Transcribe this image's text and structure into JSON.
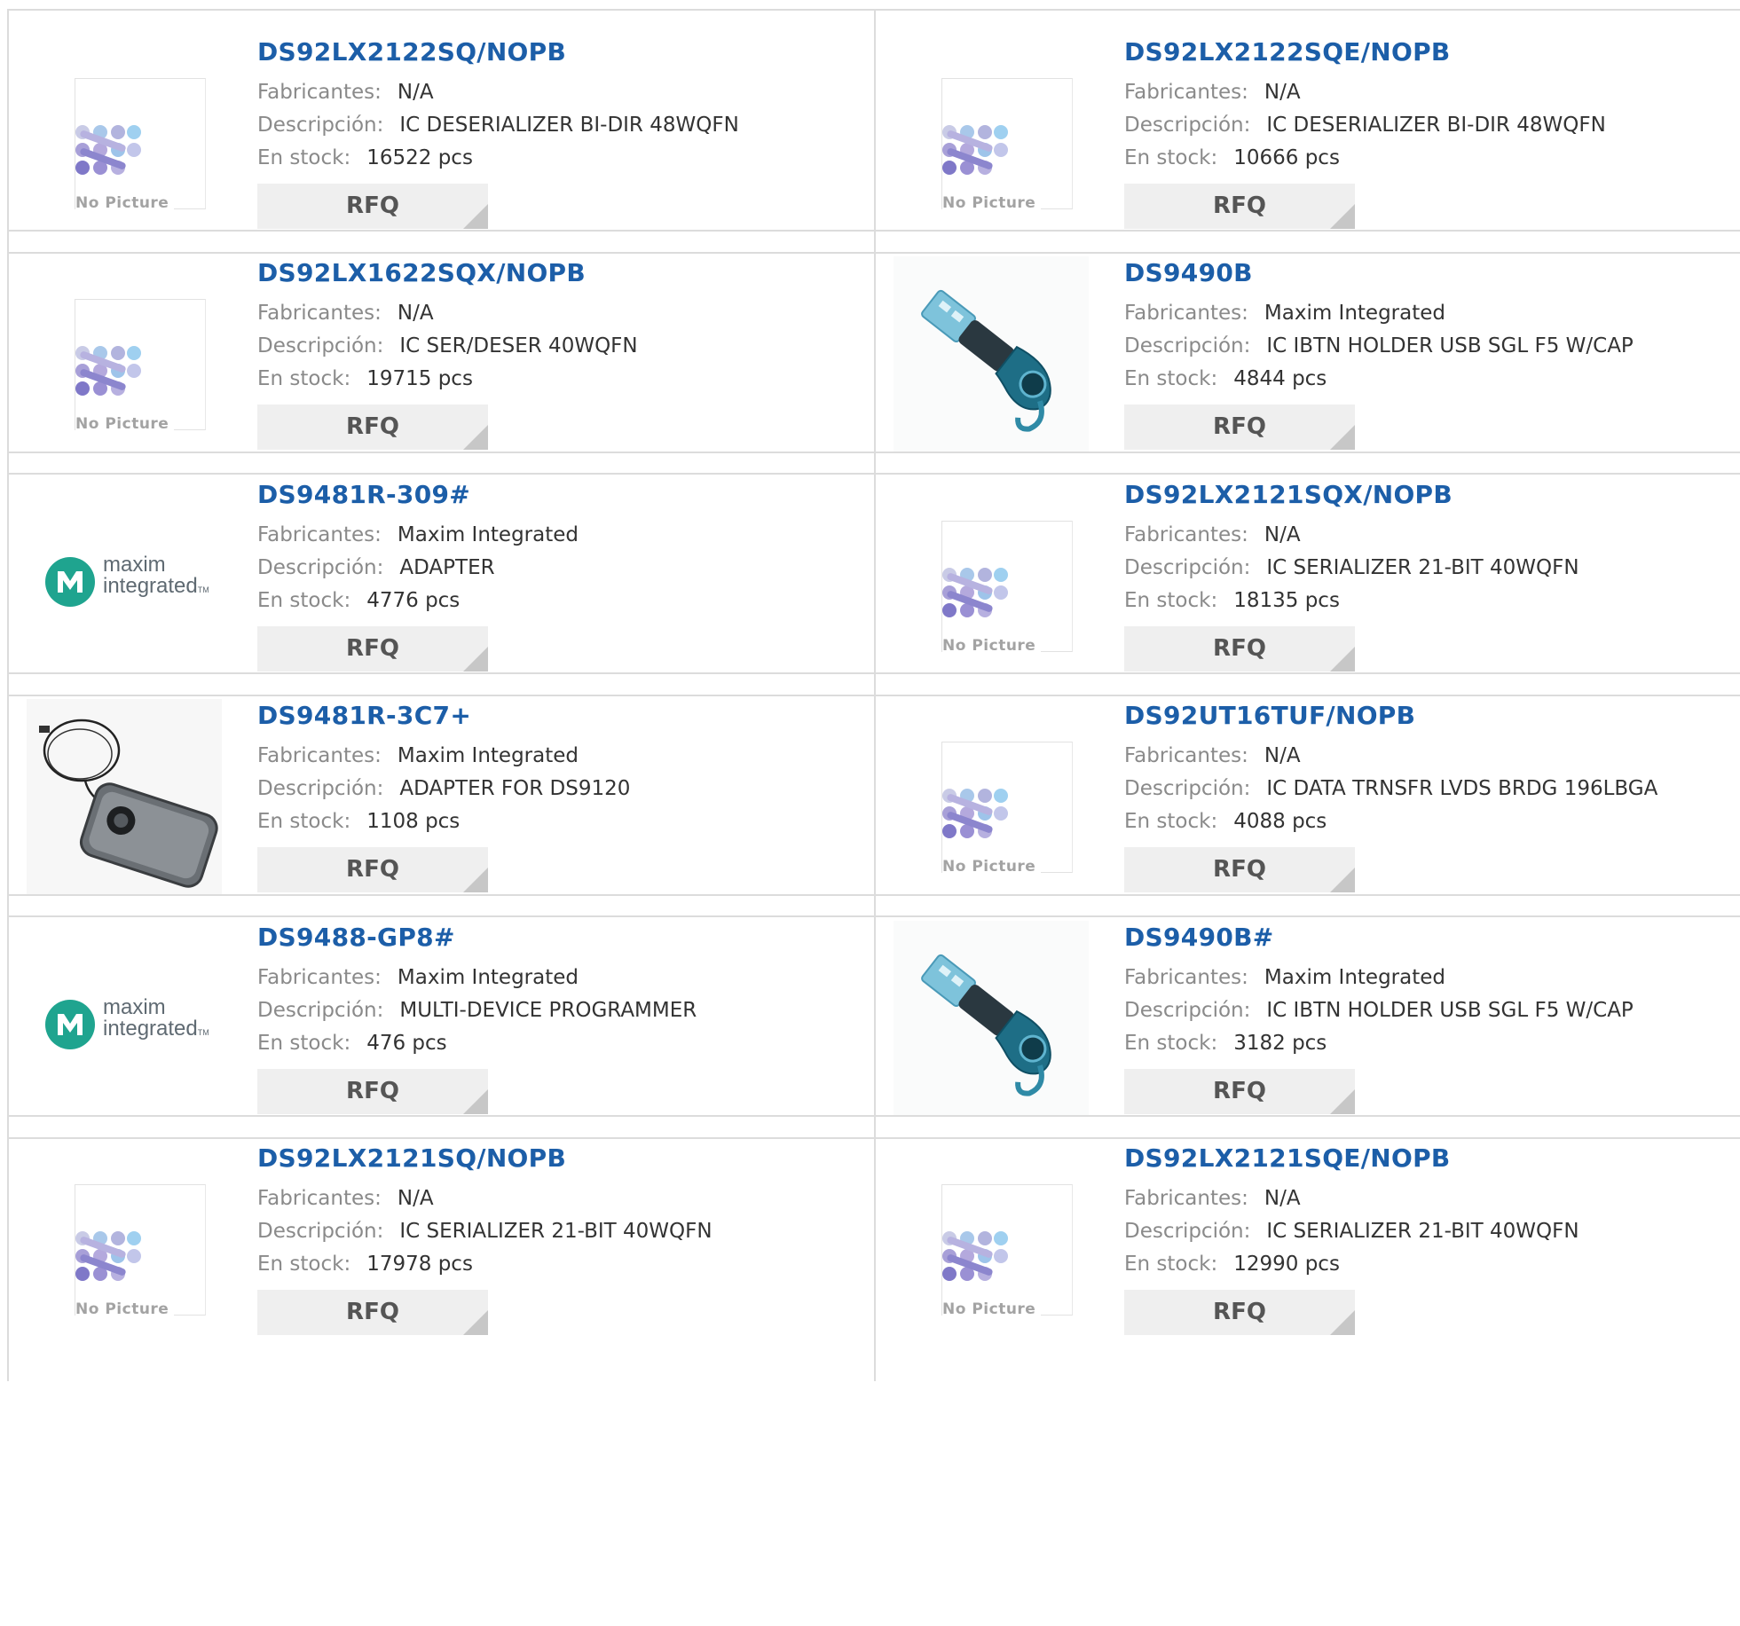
{
  "labels": {
    "manufacturer": "Fabricantes:",
    "description": "Descripción:",
    "stock": "En stock:",
    "rfq": "RFQ",
    "no_picture": "No Picture",
    "maxim_line1": "maxim",
    "maxim_line2": "integrated",
    "maxim_tm": "TM"
  },
  "colors": {
    "part_link": "#1c5ea8",
    "label_grey": "#8a8a8a",
    "value_text": "#333333",
    "rfq_bg": "#efefef",
    "border": "#dcdcdc",
    "maxim_teal": "#1fa48f"
  },
  "products": [
    {
      "part": "DS92LX2122SQ/NOPB",
      "manufacturer": "N/A",
      "description": "IC DESERIALIZER BI-DIR 48WQFN",
      "stock": "16522 pcs",
      "image": "no-picture"
    },
    {
      "part": "DS92LX2122SQE/NOPB",
      "manufacturer": "N/A",
      "description": "IC DESERIALIZER BI-DIR 48WQFN",
      "stock": "10666 pcs",
      "image": "no-picture"
    },
    {
      "part": "DS92LX1622SQX/NOPB",
      "manufacturer": "N/A",
      "description": "IC SER/DESER 40WQFN",
      "stock": "19715 pcs",
      "image": "no-picture"
    },
    {
      "part": "DS9490B",
      "manufacturer": "Maxim Integrated",
      "description": "IC IBTN HOLDER USB SGL F5 W/CAP",
      "stock": "4844 pcs",
      "image": "usb-holder"
    },
    {
      "part": "DS9481R-309#",
      "manufacturer": "Maxim Integrated",
      "description": "ADAPTER",
      "stock": "4776 pcs",
      "image": "maxim-logo"
    },
    {
      "part": "DS92LX2121SQX/NOPB",
      "manufacturer": "N/A",
      "description": "IC SERIALIZER 21-BIT 40WQFN",
      "stock": "18135 pcs",
      "image": "no-picture"
    },
    {
      "part": "DS9481R-3C7+",
      "manufacturer": "Maxim Integrated",
      "description": "ADAPTER FOR DS9120",
      "stock": "1108 pcs",
      "image": "adapter-device"
    },
    {
      "part": "DS92UT16TUF/NOPB",
      "manufacturer": "N/A",
      "description": "IC DATA TRNSFR LVDS BRDG 196LBGA",
      "stock": "4088 pcs",
      "image": "no-picture"
    },
    {
      "part": "DS9488-GP8#",
      "manufacturer": "Maxim Integrated",
      "description": "MULTI-DEVICE PROGRAMMER",
      "stock": "476 pcs",
      "image": "maxim-logo"
    },
    {
      "part": "DS9490B#",
      "manufacturer": "Maxim Integrated",
      "description": "IC IBTN HOLDER USB SGL F5 W/CAP",
      "stock": "3182 pcs",
      "image": "usb-holder"
    },
    {
      "part": "DS92LX2121SQ/NOPB",
      "manufacturer": "N/A",
      "description": "IC SERIALIZER 21-BIT 40WQFN",
      "stock": "17978 pcs",
      "image": "no-picture"
    },
    {
      "part": "DS92LX2121SQE/NOPB",
      "manufacturer": "N/A",
      "description": "IC SERIALIZER 21-BIT 40WQFN",
      "stock": "12990 pcs",
      "image": "no-picture"
    }
  ]
}
